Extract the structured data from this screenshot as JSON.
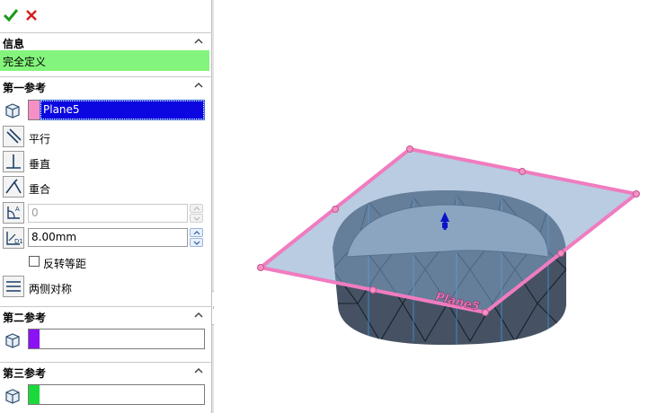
{
  "toolbar": {
    "ok": "check-icon",
    "cancel": "close-icon"
  },
  "info": {
    "title": "信息",
    "status": "完全定义",
    "status_color": "#84f57c"
  },
  "ref1": {
    "title": "第一参考",
    "selection": "Plane5",
    "swatch_color": "#f58fc4",
    "options": {
      "parallel": "平行",
      "perpendicular": "垂直",
      "coincident": "重合"
    },
    "angle_value": "0",
    "distance_value": "8.00mm",
    "flip_offset": "反转等距",
    "mid_plane": "两侧对称"
  },
  "ref2": {
    "title": "第二参考",
    "swatch_color": "#8a12f5"
  },
  "ref3": {
    "title": "第三参考",
    "swatch_color": "#1bd93b"
  },
  "viewport": {
    "plane_label": "Plane5",
    "plane_color": "#f07cc0"
  }
}
